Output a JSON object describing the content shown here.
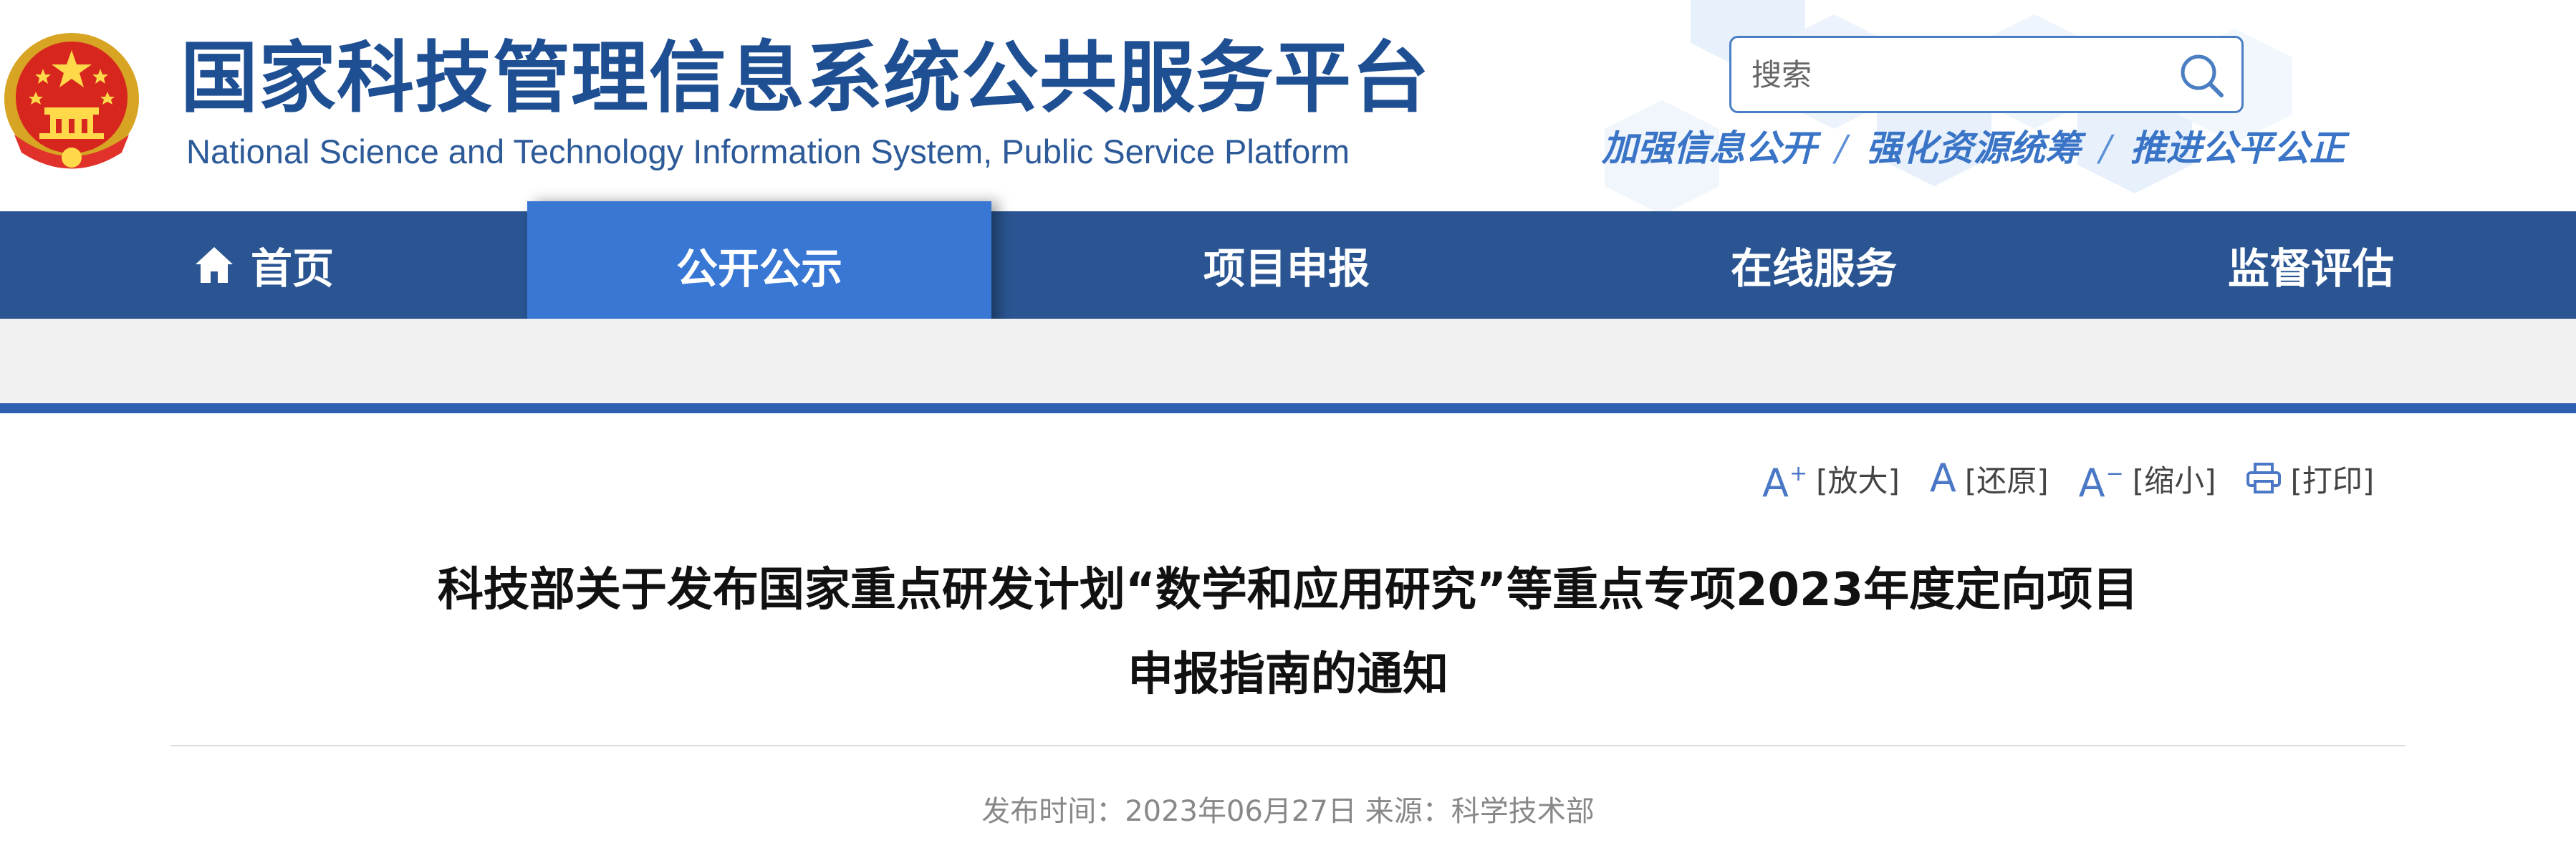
{
  "header": {
    "site_title": "国家科技管理信息系统公共服务平台",
    "site_subtitle": "National Science and Technology Information System, Public Service Platform",
    "search_placeholder": "搜索",
    "slogan": [
      "加强信息公开",
      "强化资源统筹",
      "推进公平公正"
    ],
    "slogan_separator": "/"
  },
  "nav": {
    "items": [
      {
        "label": "首页",
        "icon": "home-icon"
      },
      {
        "label": "公开公示",
        "active": true
      },
      {
        "label": "项目申报"
      },
      {
        "label": "在线服务"
      },
      {
        "label": "监督评估"
      }
    ]
  },
  "tools": {
    "enlarge": {
      "icon": "A+",
      "label": "[放大]"
    },
    "reset": {
      "icon": "A",
      "label": "[还原]"
    },
    "shrink": {
      "icon": "A−",
      "label": "[缩小]"
    },
    "print": {
      "icon": "printer-icon",
      "label": "[打印]"
    }
  },
  "article": {
    "title_line1": "科技部关于发布国家重点研发计划“数学和应用研究”等重点专项2023年度定向项目",
    "title_line2": "申报指南的通知",
    "publish_label": "发布时间：",
    "publish_date": "2023年06月27日",
    "source_label": "来源：",
    "source": "科学技术部"
  },
  "colors": {
    "title_blue": "#1f4f93",
    "nav_bg": "#2a5592",
    "nav_active": "#3877d4",
    "slogan_blue": "#3a74c6",
    "rule_blue": "#2e5fb0"
  }
}
